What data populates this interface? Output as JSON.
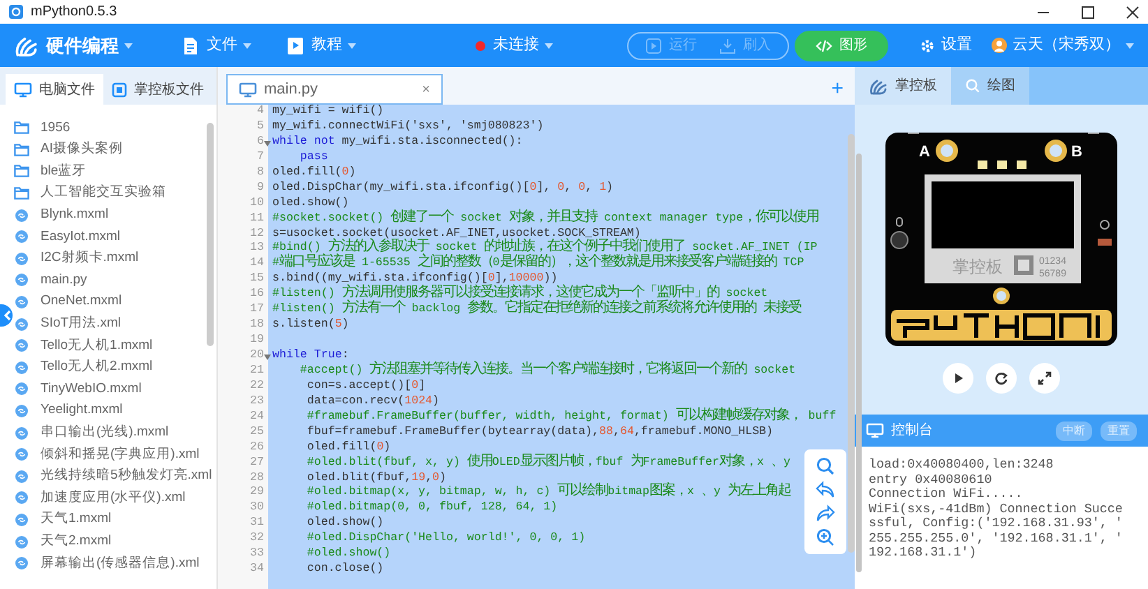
{
  "window": {
    "title": "mPython0.5.3"
  },
  "toolbar": {
    "brand": "硬件编程",
    "menus": [
      {
        "label": "文件",
        "kind": "file"
      },
      {
        "label": "教程",
        "kind": "tutorial"
      }
    ],
    "connection": {
      "label": "未连接",
      "connected": false
    },
    "actions": [
      {
        "label": "运行",
        "kind": "run",
        "disabled": true
      },
      {
        "label": "刷入",
        "kind": "flash",
        "disabled": true
      },
      {
        "label": "图形",
        "kind": "blocks",
        "disabled": false
      }
    ],
    "settings": "设置",
    "user": "云天（宋秀双）"
  },
  "file_panel": {
    "tabs": [
      {
        "label": "电脑文件",
        "kind": "computer",
        "selected": true
      },
      {
        "label": "掌控板文件",
        "kind": "board",
        "selected": false
      }
    ],
    "items": [
      {
        "name": "1956",
        "kind": "folder"
      },
      {
        "name": "AI摄像头案例",
        "kind": "folder"
      },
      {
        "name": "ble蓝牙",
        "kind": "folder"
      },
      {
        "name": "人工智能交互实验箱",
        "kind": "folder"
      },
      {
        "name": "Blynk.mxml",
        "kind": "file"
      },
      {
        "name": "EasyIot.mxml",
        "kind": "file"
      },
      {
        "name": "I2C射频卡.mxml",
        "kind": "file"
      },
      {
        "name": "main.py",
        "kind": "file"
      },
      {
        "name": "OneNet.mxml",
        "kind": "file"
      },
      {
        "name": "SIoT用法.xml",
        "kind": "file"
      },
      {
        "name": "Tello无人机1.mxml",
        "kind": "file"
      },
      {
        "name": "Tello无人机2.mxml",
        "kind": "file"
      },
      {
        "name": "TinyWebIO.mxml",
        "kind": "file"
      },
      {
        "name": "Yeelight.mxml",
        "kind": "file"
      },
      {
        "name": "串口输出(光线).mxml",
        "kind": "file"
      },
      {
        "name": "倾斜和摇晃(字典应用).xml",
        "kind": "file"
      },
      {
        "name": "光线持续暗5秒触发灯亮.xml",
        "kind": "file"
      },
      {
        "name": "加速度应用(水平仪).xml",
        "kind": "file"
      },
      {
        "name": "天气1.mxml",
        "kind": "file"
      },
      {
        "name": "天气2.mxml",
        "kind": "file"
      },
      {
        "name": "屏幕输出(传感器信息).xml",
        "kind": "file"
      }
    ]
  },
  "editor": {
    "tabs": [
      {
        "label": "main.py",
        "close": "×",
        "selected": true
      }
    ],
    "add": "+",
    "all_selected": true,
    "lines": [
      {
        "number": "4",
        "segments": [
          {
            "kind": "plain",
            "text": "my_wifi = wifi()"
          }
        ]
      },
      {
        "number": "5",
        "segments": [
          {
            "kind": "plain",
            "text": "my_wifi.connectWiFi('sxs', 'smj080823')"
          }
        ]
      },
      {
        "number": "6",
        "fold": true,
        "segments": [
          {
            "kind": "keyword",
            "text": "while"
          },
          {
            "kind": "keyword",
            "text": " not"
          },
          {
            "kind": "plain",
            "text": " my_wifi.sta.isconnected():"
          }
        ]
      },
      {
        "number": "7",
        "segments": [
          {
            "kind": "keyword",
            "text": "    pass"
          }
        ]
      },
      {
        "number": "8",
        "segments": [
          {
            "kind": "plain",
            "text": "oled.fill("
          },
          {
            "kind": "number",
            "text": "0"
          },
          {
            "kind": "plain",
            "text": ")"
          }
        ]
      },
      {
        "number": "9",
        "segments": [
          {
            "kind": "plain",
            "text": "oled.DispChar(my_wifi.sta.ifconfig()["
          },
          {
            "kind": "number",
            "text": "0"
          },
          {
            "kind": "plain",
            "text": "], "
          },
          {
            "kind": "number",
            "text": "0"
          },
          {
            "kind": "plain",
            "text": ", "
          },
          {
            "kind": "number",
            "text": "0"
          },
          {
            "kind": "plain",
            "text": ", "
          },
          {
            "kind": "number",
            "text": "1"
          },
          {
            "kind": "plain",
            "text": ")"
          }
        ]
      },
      {
        "number": "10",
        "segments": [
          {
            "kind": "plain",
            "text": "oled.show()"
          }
        ]
      },
      {
        "number": "11",
        "segments": [
          {
            "kind": "comment",
            "text": "#socket.socket() 创建了一个 socket 对象，并且支持 context manager type，你可以使用"
          }
        ]
      },
      {
        "number": "12",
        "segments": [
          {
            "kind": "plain",
            "text": "s=usocket.socket(usocket.AF_INET,usocket.SOCK_STREAM)"
          }
        ]
      },
      {
        "number": "13",
        "segments": [
          {
            "kind": "comment",
            "text": "#bind() 方法的入参取决于 socket 的地址族，在这个例子中我们使用了 socket.AF_INET (IP"
          }
        ]
      },
      {
        "number": "14",
        "segments": [
          {
            "kind": "comment",
            "text": "#端口号应该是 1-65535 之间的整数（0是保留的），这个整数就是用来接受客户端链接的 TCP"
          }
        ]
      },
      {
        "number": "15",
        "segments": [
          {
            "kind": "plain",
            "text": "s.bind((my_wifi.sta.ifconfig()["
          },
          {
            "kind": "number",
            "text": "0"
          },
          {
            "kind": "plain",
            "text": "],"
          },
          {
            "kind": "number",
            "text": "10000"
          },
          {
            "kind": "plain",
            "text": "))"
          }
        ]
      },
      {
        "number": "16",
        "segments": [
          {
            "kind": "comment",
            "text": "#listen() 方法调用使服务器可以接受连接请求，这使它成为一个「监听中」的 socket"
          }
        ]
      },
      {
        "number": "17",
        "segments": [
          {
            "kind": "comment",
            "text": "#listen() 方法有一个 backlog 参数。它指定在拒绝新的连接之前系统将允许使用的 未接受"
          }
        ]
      },
      {
        "number": "18",
        "segments": [
          {
            "kind": "plain",
            "text": "s.listen("
          },
          {
            "kind": "number",
            "text": "5"
          },
          {
            "kind": "plain",
            "text": ")"
          }
        ]
      },
      {
        "number": "19"
      },
      {
        "number": "20",
        "fold": true,
        "segments": [
          {
            "kind": "keyword",
            "text": "while"
          },
          {
            "kind": "keyword",
            "text": " True"
          },
          {
            "kind": "plain",
            "text": ":"
          }
        ]
      },
      {
        "number": "21",
        "segments": [
          {
            "kind": "comment",
            "text": "    #accept() 方法阻塞并等待传入连接。当一个客户端连接时，它将返回一个新的 socket"
          }
        ]
      },
      {
        "number": "22",
        "segments": [
          {
            "kind": "plain",
            "text": "     con=s.accept()["
          },
          {
            "kind": "number",
            "text": "0"
          },
          {
            "kind": "plain",
            "text": "]"
          }
        ]
      },
      {
        "number": "23",
        "segments": [
          {
            "kind": "plain",
            "text": "     data=con.recv("
          },
          {
            "kind": "number",
            "text": "1024"
          },
          {
            "kind": "plain",
            "text": ")"
          }
        ]
      },
      {
        "number": "24",
        "segments": [
          {
            "kind": "comment",
            "text": "     #framebuf.FrameBuffer(buffer, width, height, format) 可以构建帧缓存对象， buff"
          }
        ]
      },
      {
        "number": "25",
        "segments": [
          {
            "kind": "plain",
            "text": "     fbuf=framebuf.FrameBuffer(bytearray(data),"
          },
          {
            "kind": "number",
            "text": "88"
          },
          {
            "kind": "plain",
            "text": ","
          },
          {
            "kind": "number",
            "text": "64"
          },
          {
            "kind": "plain",
            "text": ",framebuf.MONO_HLSB)"
          }
        ]
      },
      {
        "number": "26",
        "segments": [
          {
            "kind": "plain",
            "text": "     oled.fill("
          },
          {
            "kind": "number",
            "text": "0"
          },
          {
            "kind": "plain",
            "text": ")"
          }
        ]
      },
      {
        "number": "27",
        "segments": [
          {
            "kind": "comment",
            "text": "     #oled.blit(fbuf, x, y) 使用OLED显示图片帧，fbuf 为FrameBuffer对象，x 、y"
          }
        ]
      },
      {
        "number": "28",
        "segments": [
          {
            "kind": "plain",
            "text": "     oled.blit(fbuf,"
          },
          {
            "kind": "number",
            "text": "19"
          },
          {
            "kind": "plain",
            "text": ","
          },
          {
            "kind": "number",
            "text": "0"
          },
          {
            "kind": "plain",
            "text": ")"
          }
        ]
      },
      {
        "number": "29",
        "segments": [
          {
            "kind": "comment",
            "text": "     #oled.bitmap(x, y, bitmap, w, h, c) 可以绘制bitmap图案，x 、y 为左上角起"
          }
        ]
      },
      {
        "number": "30",
        "segments": [
          {
            "kind": "comment",
            "text": "     #oled.bitmap(0, 0, fbuf, 128, 64, 1)"
          }
        ]
      },
      {
        "number": "31",
        "segments": [
          {
            "kind": "plain",
            "text": "     oled.show()"
          }
        ]
      },
      {
        "number": "32",
        "segments": [
          {
            "kind": "comment",
            "text": "     #oled.DispChar('Hello, world!', 0, 0, 1)"
          }
        ]
      },
      {
        "number": "33",
        "segments": [
          {
            "kind": "comment",
            "text": "     #oled.show()"
          }
        ]
      },
      {
        "number": "34",
        "segments": [
          {
            "kind": "plain",
            "text": "     con.close()"
          }
        ]
      }
    ]
  },
  "device_panel": {
    "tabs": [
      {
        "label": "掌控板",
        "kind": "board",
        "selected": true
      },
      {
        "label": "绘图",
        "kind": "plot",
        "selected": false
      }
    ],
    "board_labels": {
      "button_a": "A",
      "button_b": "B",
      "brand": "掌控板",
      "digits_1": "01234",
      "digits_2": "56789"
    },
    "console": {
      "title": "控制台",
      "buttons": [
        "中断",
        "重置"
      ],
      "output": [
        "load:0x40080400,len:3248",
        "entry 0x40080610",
        "Connection WiFi.....",
        "WiFi(sxs,-41dBm) Connection Succe",
        "ssful, Config:('192.168.31.93', '",
        "255.255.255.0', '192.168.31.1', '",
        "192.168.31.1')"
      ]
    }
  }
}
